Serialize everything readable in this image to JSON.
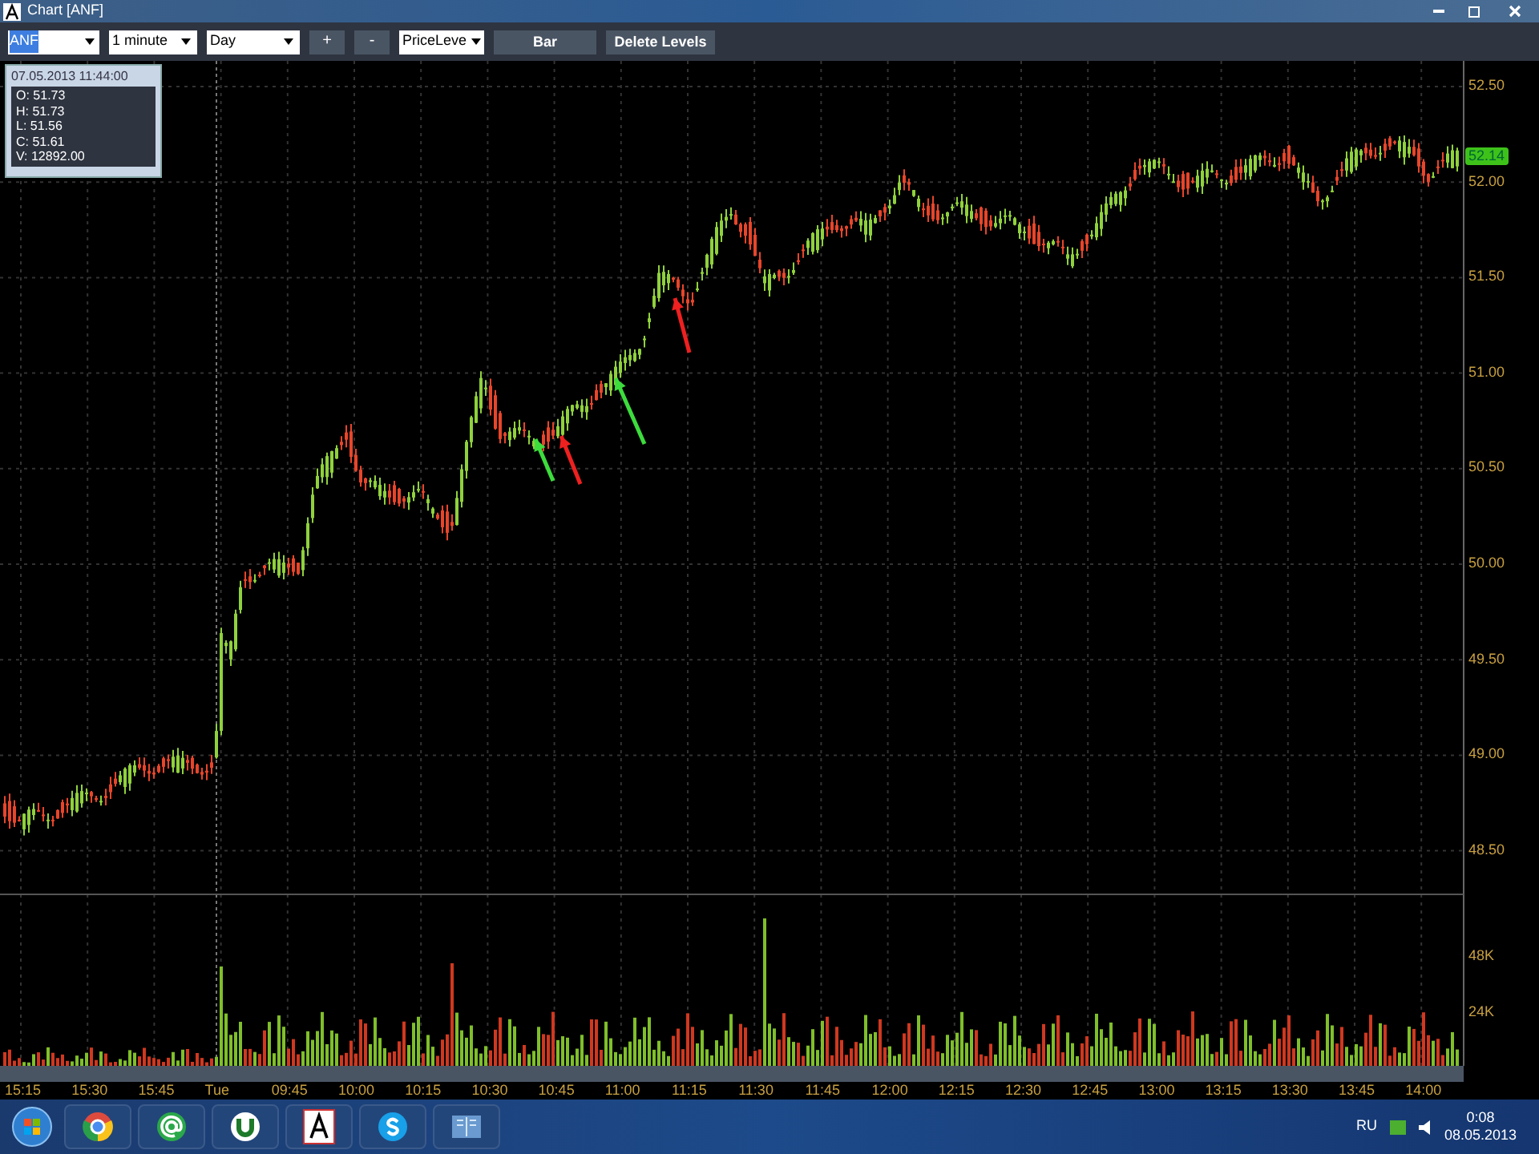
{
  "window": {
    "title": "Chart [ANF]"
  },
  "toolbar": {
    "symbol": "ANF",
    "interval": "1 minute",
    "period": "Day",
    "zoom_in": "+",
    "zoom_out": "-",
    "levels": "PriceLeve",
    "chart_type": "Bar",
    "delete": "Delete Levels"
  },
  "info_box": {
    "timestamp": "07.05.2013 11:44:00",
    "lines": [
      "O: 51.73",
      "H: 51.73",
      "L: 51.56",
      "C: 51.61",
      "V: 12892.00"
    ]
  },
  "price_axis": {
    "labels": [
      "52.50",
      "52.00",
      "51.50",
      "51.00",
      "50.50",
      "50.00",
      "49.50",
      "49.00",
      "48.50"
    ],
    "last_price": "52.14"
  },
  "volume_axis": {
    "labels": [
      "48K",
      "24K"
    ]
  },
  "time_axis": {
    "labels": [
      "15:15",
      "15:30",
      "15:45",
      "Tue",
      "09:45",
      "10:00",
      "10:15",
      "10:30",
      "10:45",
      "11:00",
      "11:15",
      "11:30",
      "11:45",
      "12:00",
      "12:15",
      "12:30",
      "12:45",
      "13:00",
      "13:15",
      "13:30",
      "13:45",
      "14:00"
    ]
  },
  "taskbar": {
    "language": "RU",
    "time": "0:08",
    "date": "08.05.2013"
  }
}
